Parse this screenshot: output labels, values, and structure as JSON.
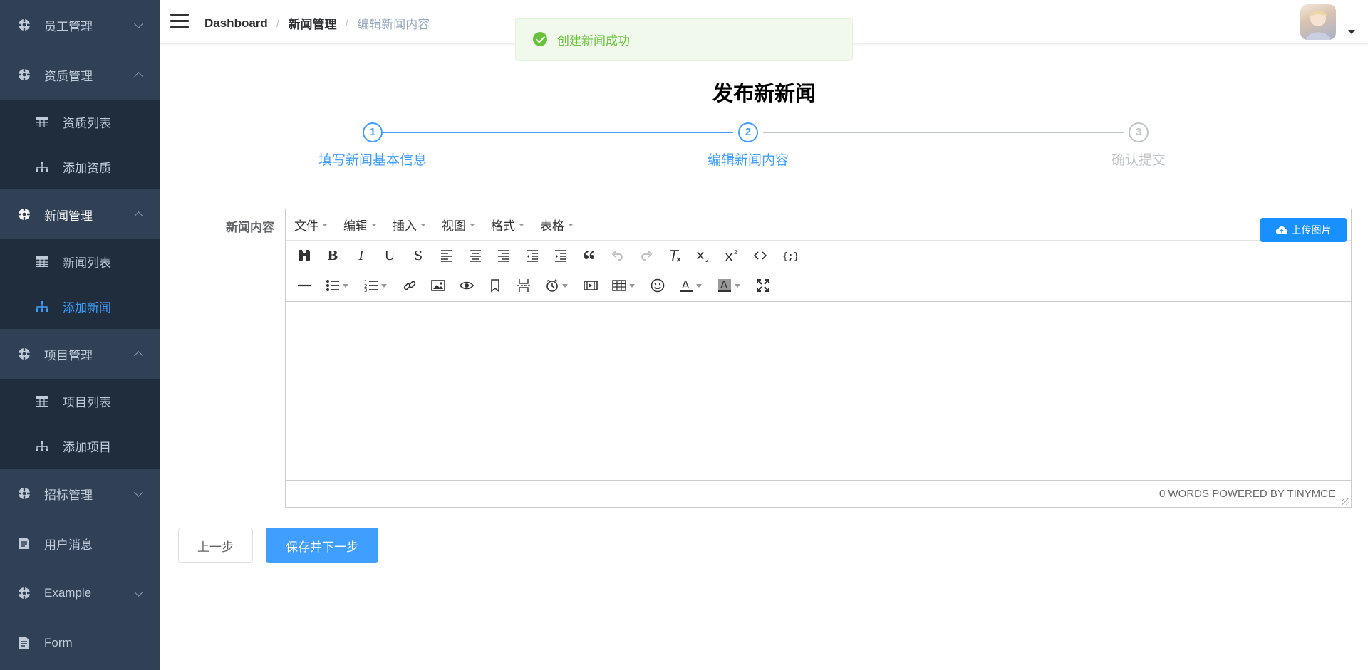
{
  "sidebar": {
    "items": [
      {
        "label": "员工管理",
        "icon": "gear-icon",
        "arrow": "down"
      },
      {
        "label": "资质管理",
        "icon": "gear-icon",
        "arrow": "up",
        "children": [
          {
            "label": "资质列表",
            "icon": "table-icon"
          },
          {
            "label": "添加资质",
            "icon": "tree-icon"
          }
        ]
      },
      {
        "label": "新闻管理",
        "icon": "gear-icon",
        "arrow": "up",
        "children": [
          {
            "label": "新闻列表",
            "icon": "table-icon"
          },
          {
            "label": "添加新闻",
            "icon": "tree-icon",
            "active": true
          }
        ]
      },
      {
        "label": "项目管理",
        "icon": "gear-icon",
        "arrow": "up",
        "children": [
          {
            "label": "项目列表",
            "icon": "table-icon"
          },
          {
            "label": "添加项目",
            "icon": "tree-icon"
          }
        ]
      },
      {
        "label": "招标管理",
        "icon": "gear-icon",
        "arrow": "down"
      },
      {
        "label": "用户消息",
        "icon": "document-icon"
      },
      {
        "label": "Example",
        "icon": "gear-icon",
        "arrow": "down"
      },
      {
        "label": "Form",
        "icon": "document-icon"
      }
    ]
  },
  "navbar": {
    "breadcrumb": [
      "Dashboard",
      "新闻管理",
      "编辑新闻内容"
    ]
  },
  "toast": {
    "message": "创建新闻成功",
    "color": "#67c23a"
  },
  "page": {
    "title": "发布新新闻",
    "steps": [
      {
        "number": "1",
        "label": "填写新闻基本信息",
        "status": "done"
      },
      {
        "number": "2",
        "label": "编辑新闻内容",
        "status": "current"
      },
      {
        "number": "3",
        "label": "确认提交",
        "status": "todo"
      }
    ],
    "form_label": "新闻内容"
  },
  "editor": {
    "menus": [
      "文件",
      "编辑",
      "插入",
      "视图",
      "格式",
      "表格"
    ],
    "upload_label": "上传图片",
    "status": "0 WORDS POWERED BY TINYMCE"
  },
  "buttons": {
    "prev": "上一步",
    "next": "保存并下一步"
  },
  "colors": {
    "sidebar": "#304156",
    "submenu": "#1f2d3d",
    "primary": "#409eff",
    "upload": "#1890ff"
  }
}
